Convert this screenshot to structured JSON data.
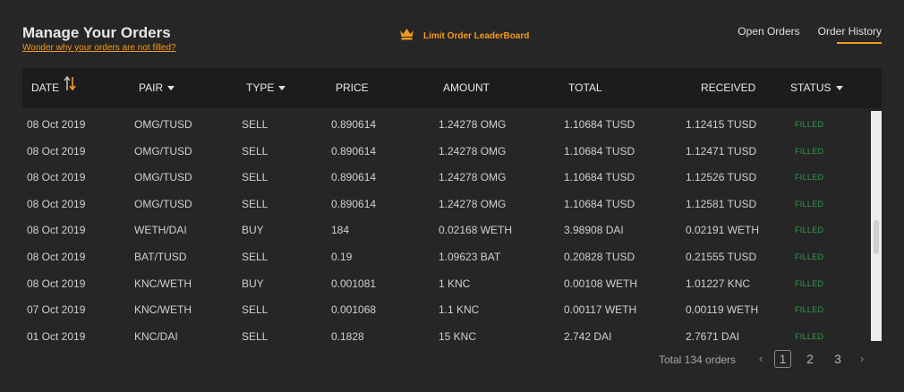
{
  "header": {
    "title": "Manage Your Orders",
    "help_link": "Wonder why your orders are not filled?",
    "leaderboard_label": "Limit Order LeaderBoard",
    "leaderboard_icon": "crown-icon"
  },
  "tabs": [
    {
      "label": "Open Orders",
      "active": false
    },
    {
      "label": "Order History",
      "active": true
    }
  ],
  "columns": {
    "date": "DATE",
    "pair": "PAIR",
    "type": "TYPE",
    "price": "PRICE",
    "amount": "AMOUNT",
    "total": "TOTAL",
    "received": "RECEIVED",
    "status": "STATUS"
  },
  "orders": [
    {
      "date": "08 Oct 2019",
      "pair": "OMG/TUSD",
      "type": "SELL",
      "price": "0.890614",
      "amount": "1.24278 OMG",
      "total": "1.10684 TUSD",
      "received": "1.12415 TUSD",
      "status": "FILLED"
    },
    {
      "date": "08 Oct 2019",
      "pair": "OMG/TUSD",
      "type": "SELL",
      "price": "0.890614",
      "amount": "1.24278 OMG",
      "total": "1.10684 TUSD",
      "received": "1.12471 TUSD",
      "status": "FILLED"
    },
    {
      "date": "08 Oct 2019",
      "pair": "OMG/TUSD",
      "type": "SELL",
      "price": "0.890614",
      "amount": "1.24278 OMG",
      "total": "1.10684 TUSD",
      "received": "1.12526 TUSD",
      "status": "FILLED"
    },
    {
      "date": "08 Oct 2019",
      "pair": "OMG/TUSD",
      "type": "SELL",
      "price": "0.890614",
      "amount": "1.24278 OMG",
      "total": "1.10684 TUSD",
      "received": "1.12581 TUSD",
      "status": "FILLED"
    },
    {
      "date": "08 Oct 2019",
      "pair": "WETH/DAI",
      "type": "BUY",
      "price": "184",
      "amount": "0.02168 WETH",
      "total": "3.98908 DAI",
      "received": "0.02191 WETH",
      "status": "FILLED"
    },
    {
      "date": "08 Oct 2019",
      "pair": "BAT/TUSD",
      "type": "SELL",
      "price": "0.19",
      "amount": "1.09623 BAT",
      "total": "0.20828 TUSD",
      "received": "0.21555 TUSD",
      "status": "FILLED"
    },
    {
      "date": "08 Oct 2019",
      "pair": "KNC/WETH",
      "type": "BUY",
      "price": "0.001081",
      "amount": "1 KNC",
      "total": "0.00108 WETH",
      "received": "1.01227 KNC",
      "status": "FILLED"
    },
    {
      "date": "07 Oct 2019",
      "pair": "KNC/WETH",
      "type": "SELL",
      "price": "0.001068",
      "amount": "1.1 KNC",
      "total": "0.00117 WETH",
      "received": "0.00119 WETH",
      "status": "FILLED"
    },
    {
      "date": "01 Oct 2019",
      "pair": "KNC/DAI",
      "type": "SELL",
      "price": "0.1828",
      "amount": "15 KNC",
      "total": "2.742 DAI",
      "received": "2.7671 DAI",
      "status": "FILLED"
    }
  ],
  "footer": {
    "total_label": "Total 134 orders",
    "pages": [
      "1",
      "2",
      "3"
    ],
    "current_page": "1",
    "prev_symbol": "‹",
    "next_symbol": "›"
  },
  "colors": {
    "accent": "#f29a1e",
    "filled": "#2f9a4f",
    "background": "#262626",
    "header_bg": "#1c1c1c"
  }
}
